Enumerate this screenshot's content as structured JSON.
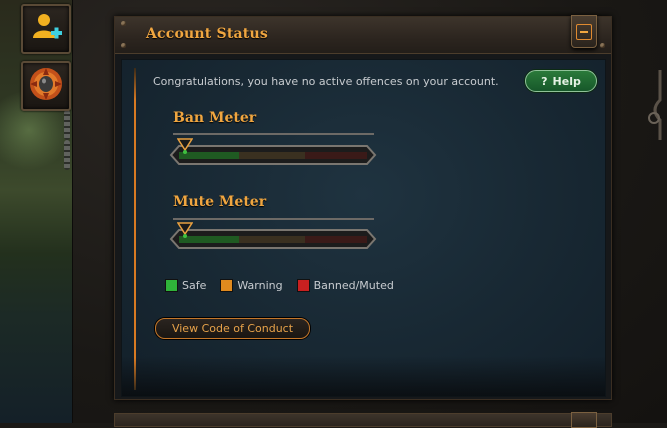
{
  "sidebar": {
    "buttons": [
      {
        "icon": "add-user-icon"
      },
      {
        "icon": "skull-badge-icon"
      }
    ]
  },
  "panel": {
    "title": "Account Status",
    "collapse_icon": "minus-icon",
    "message": "Congratulations, you have no active offences on your account.",
    "help": {
      "icon": "question-icon",
      "label": "Help"
    },
    "meters": [
      {
        "label": "Ban Meter",
        "level": 0
      },
      {
        "label": "Mute Meter",
        "level": 0
      }
    ],
    "legend": [
      {
        "label": "Safe",
        "color": "#2fb33a"
      },
      {
        "label": "Warning",
        "color": "#e08a1e"
      },
      {
        "label": "Banned/Muted",
        "color": "#c82020"
      }
    ],
    "code_of_conduct_button": "View Code of Conduct"
  },
  "colors": {
    "accent": "#f0a640",
    "help_green": "#1f6a31",
    "content_bg": "#182833"
  }
}
